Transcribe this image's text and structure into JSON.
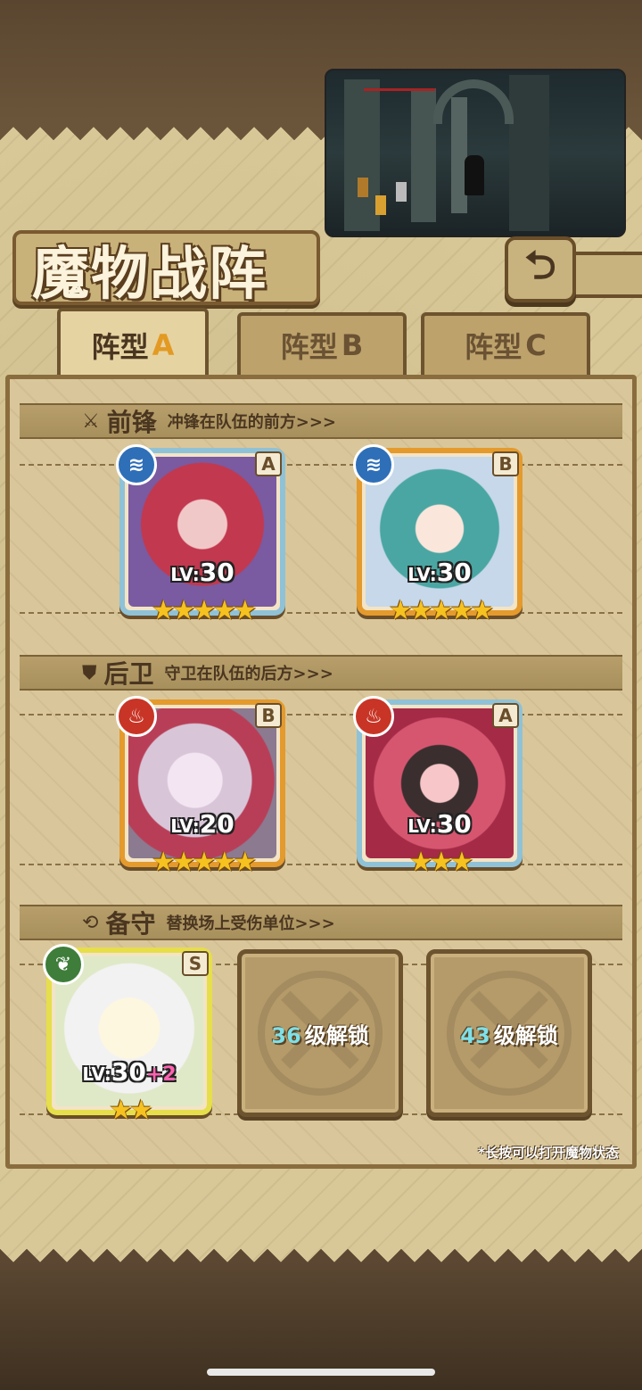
{
  "header": {
    "title": "魔物战阵",
    "back_icon": "back-arrow-icon"
  },
  "tabs": [
    {
      "label": "阵型",
      "letter": "A",
      "active": true
    },
    {
      "label": "阵型",
      "letter": "B",
      "active": false
    },
    {
      "label": "阵型",
      "letter": "C",
      "active": false
    }
  ],
  "sections": {
    "front": {
      "name": "前锋",
      "desc": "冲锋在队伍的前方>>>",
      "icon": "sword-icon"
    },
    "rear": {
      "name": "后卫",
      "desc": "守卫在队伍的后方>>>",
      "icon": "shield-icon"
    },
    "reserve": {
      "name": "备守",
      "desc": "替换场上受伤单位>>>",
      "icon": "swap-icon"
    }
  },
  "units": {
    "front_1": {
      "rank": "A",
      "element": "water",
      "lv_prefix": "LV:",
      "lv": "30",
      "stars": 5
    },
    "front_2": {
      "rank": "B",
      "element": "water",
      "lv_prefix": "LV:",
      "lv": "30",
      "stars": 5
    },
    "rear_1": {
      "rank": "B",
      "element": "fire",
      "lv_prefix": "LV:",
      "lv": "20",
      "stars": 5
    },
    "rear_2": {
      "rank": "A",
      "element": "fire",
      "lv_prefix": "LV:",
      "lv": "30",
      "stars": 3
    },
    "reserve_1": {
      "rank": "S",
      "element": "leaf",
      "lv_prefix": "LV:",
      "lv": "30",
      "bonus": "+2",
      "stars": 2
    }
  },
  "locked_slots": [
    {
      "level": "36",
      "text": "级解锁"
    },
    {
      "level": "43",
      "text": "级解锁"
    }
  ],
  "hint": "*长按可以打开魔物状态",
  "colors": {
    "accent_orange": "#e49a2c",
    "frame_blue": "#8fc2d7",
    "frame_yellow": "#e6de4a",
    "water": "#2e6fb8",
    "fire": "#c83526",
    "leaf": "#3f7d3a",
    "star": "#f6c21f"
  }
}
